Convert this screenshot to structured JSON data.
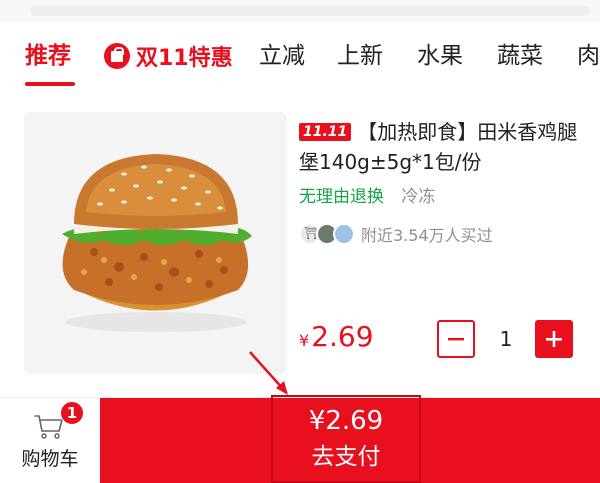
{
  "tabs": [
    {
      "label": "推荐"
    },
    {
      "label": "双11特惠"
    },
    {
      "label": "立减"
    },
    {
      "label": "上新"
    },
    {
      "label": "水果"
    },
    {
      "label": "蔬菜"
    },
    {
      "label": "肉"
    }
  ],
  "active_tab": "推荐",
  "product": {
    "badge": "11.11",
    "title": "【加热即食】田米香鸡腿堡140g±5g*1包/份",
    "tags": [
      "无理由退换",
      "冷冻"
    ],
    "buyers_text": "附近3.54万人买过",
    "price_symbol": "¥",
    "price_value": "2.69",
    "quantity": "1",
    "image_icon": "burger-image"
  },
  "cart": {
    "label": "购物车",
    "badge_count": "1",
    "icon": "shopping-cart-icon"
  },
  "checkout": {
    "price": "¥2.69",
    "label": "去支付"
  },
  "colors": {
    "accent": "#e8101e",
    "tag_green": "#17a346",
    "muted": "#8f8f8f"
  }
}
